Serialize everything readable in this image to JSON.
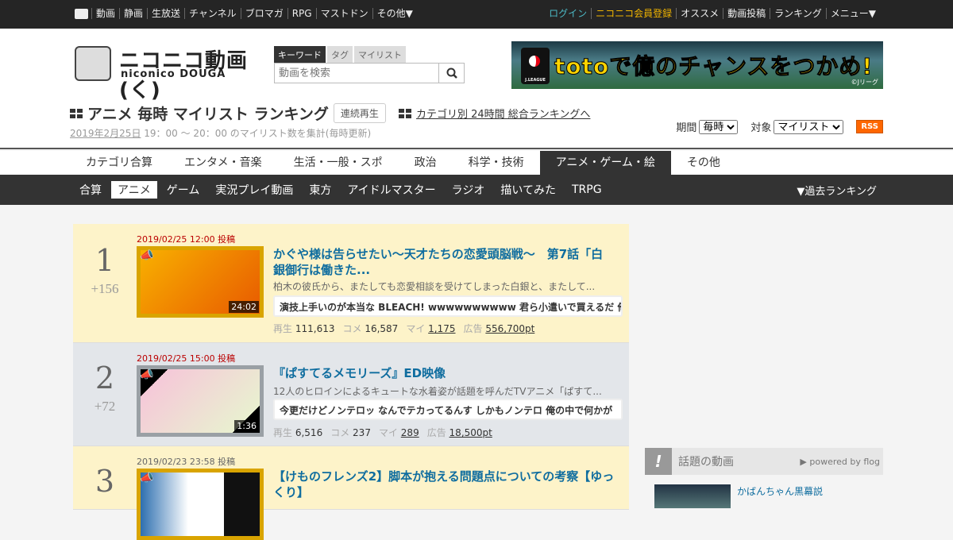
{
  "topbar": {
    "left": [
      "動画",
      "静画",
      "生放送",
      "チャンネル",
      "ブロマガ",
      "RPG",
      "マストドン",
      "その他▼"
    ],
    "login": "ログイン",
    "register": "ニコニコ会員登録",
    "right": [
      "オススメ",
      "動画投稿",
      "ランキング",
      "メニュー▼"
    ]
  },
  "logo": {
    "jp": "ニコニコ動画(く)",
    "en": "niconico DOUGA"
  },
  "search": {
    "tabs": [
      "キーワード",
      "タグ",
      "マイリスト"
    ],
    "placeholder": "動画を検索"
  },
  "banner": {
    "text": "totoで億のチャンスをつかめ!",
    "league": "J.LEAGUE",
    "copyright": "©Jリーグ"
  },
  "page": {
    "title": "アニメ 毎時 マイリスト ランキング",
    "continuous": "連続再生",
    "cat_link": "カテゴリ別 24時間 総合ランキングへ",
    "date": "2019年2月25日",
    "sub": " 19：00 ～ 20：00 のマイリスト数を集計(毎時更新)",
    "period_label": "期間",
    "period": "毎時",
    "target_label": "対象",
    "target": "マイリスト",
    "rss": "RSS"
  },
  "categories": [
    "カテゴリ合算",
    "エンタメ・音楽",
    "生活・一般・スポ",
    "政治",
    "科学・技術",
    "アニメ・ゲーム・絵",
    "その他"
  ],
  "subcategories": [
    "合算",
    "アニメ",
    "ゲーム",
    "実況プレイ動画",
    "東方",
    "アイドルマスター",
    "ラジオ",
    "描いてみた",
    "TRPG"
  ],
  "past": "▼過去ランキング",
  "labels": {
    "views": "再生",
    "comments": "コメ",
    "mylist": "マイ",
    "ad": "広告"
  },
  "items": [
    {
      "rank": "1",
      "delta": "+156",
      "date": "2019/02/25 12:00 投稿",
      "duration": "24:02",
      "title": "かぐや様は告らせたい～天才たちの恋愛頭脳戦～　第7話「白銀御行は働きた...",
      "desc": "柏木の彼氏から、またしても恋愛相談を受けてしまった白銀と、またして...",
      "comment": "演技上手いのが本当な BLEACH! wwwwwwwwww 君ら小遣いで買えるだ 俺が",
      "views": "111,613",
      "comments": "16,587",
      "mylist": "1,175",
      "ad": "556,700pt"
    },
    {
      "rank": "2",
      "delta": "+72",
      "date": "2019/02/25 15:00 投稿",
      "duration": "1:36",
      "title": "『ぱすてるメモリーズ』ED映像",
      "desc": "12人のヒロインによるキュートな水着姿が話題を呼んだTVアニメ「ぱすて...",
      "comment": "今更だけどノンテロッ なんでテカってるんす しかもノンテロ 俺の中で何かが",
      "views": "6,516",
      "comments": "237",
      "mylist": "289",
      "ad": "18,500pt"
    },
    {
      "rank": "3",
      "date": "2019/02/23 23:58 投稿",
      "title": "【けものフレンズ2】脚本が抱える問題点についての考察【ゆっくり】"
    }
  ],
  "side": {
    "title": "話題の動画",
    "powered": "▶ powered by flog",
    "items": [
      "かばんちゃん黒幕説"
    ]
  }
}
